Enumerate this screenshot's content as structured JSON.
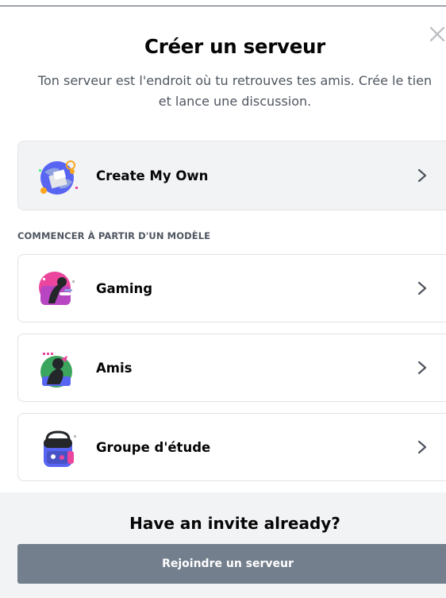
{
  "modal": {
    "title": "Créer un serveur",
    "subtitle_line1": "Ton serveur est l'endroit où tu retrouves tes amis. Crée le tien",
    "subtitle_line2": "et lance une discussion.",
    "close_icon": "close-icon"
  },
  "create_own": {
    "label": "Create My Own",
    "icon": "globe-icon"
  },
  "templates": {
    "heading": "COMMENCER À PARTIR D'UN MODÈLE",
    "items": [
      {
        "label": "Gaming",
        "icon": "gaming-icon"
      },
      {
        "label": "Amis",
        "icon": "friends-icon"
      },
      {
        "label": "Groupe d'étude",
        "icon": "backpack-icon"
      }
    ]
  },
  "footer": {
    "title": "Have an invite already?",
    "join_button": "Rejoindre un serveur"
  },
  "colors": {
    "text_primary": "#060607",
    "text_muted": "#4f5660",
    "footer_bg": "#f2f3f5",
    "button_bg": "#747f8d"
  }
}
